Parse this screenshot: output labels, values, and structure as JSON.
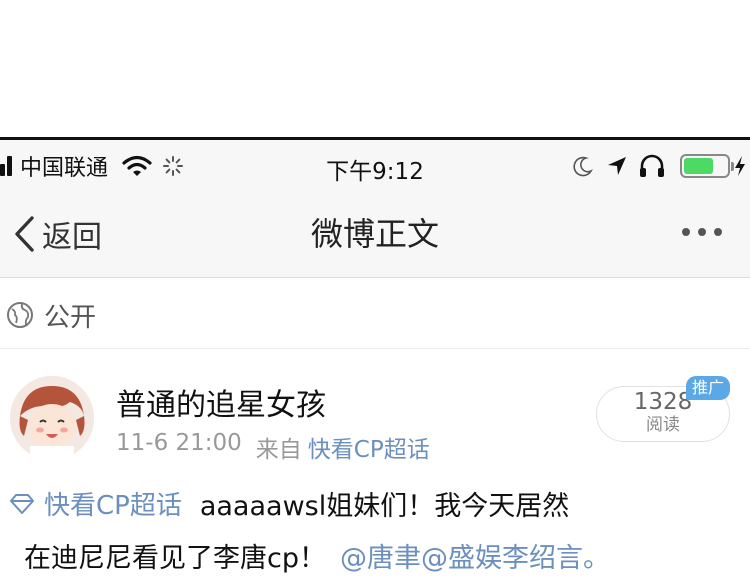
{
  "status_bar": {
    "carrier": "中国联通",
    "time": "下午9:12",
    "battery_level": 0.7,
    "battery_color": "#4cd964",
    "icons": [
      "signal-icon",
      "wifi-icon",
      "spinner-icon",
      "moon-icon",
      "location-icon",
      "headphone-icon",
      "battery-icon",
      "charging-icon"
    ]
  },
  "nav": {
    "back_label": "返回",
    "title": "微博正文",
    "more_icon": "more-dots-icon"
  },
  "visibility": {
    "label": "公开",
    "icon": "globe-icon"
  },
  "post": {
    "username": "普通的追星女孩",
    "date": "11-6 21:00",
    "via": "来自",
    "source": "快看CP超话",
    "read_count": "1328",
    "read_label": "阅读",
    "promo_badge": "推广",
    "topic_tag": "快看CP超话",
    "text_line1": "aaaaawsl姐妹们！我今天居然",
    "text_line2": "在迪尼尼看见了李唐cp！",
    "mention_line": "@唐聿@盛娱李绍言。",
    "link_color": "#6b8fbf"
  }
}
